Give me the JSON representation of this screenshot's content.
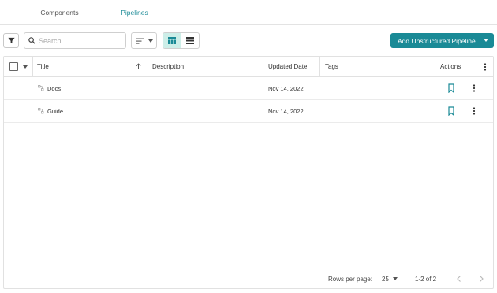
{
  "tabs": [
    {
      "label": "Components"
    },
    {
      "label": "Pipelines"
    }
  ],
  "toolbar": {
    "search_placeholder": "Search",
    "add_button_label": "Add Unstructured Pipeline"
  },
  "table": {
    "columns": {
      "title": "Title",
      "description": "Description",
      "updated_date": "Updated Date",
      "tags": "Tags",
      "actions": "Actions"
    },
    "rows": [
      {
        "title": "Docs",
        "description": "",
        "updated_date": "Nov 14, 2022",
        "tags": ""
      },
      {
        "title": "Guide",
        "description": "",
        "updated_date": "Nov 14, 2022",
        "tags": ""
      }
    ]
  },
  "pagination": {
    "rows_per_page_label": "Rows per page:",
    "rows_per_page_value": "25",
    "range": "1-2 of 2"
  },
  "colors": {
    "accent": "#1a8a96",
    "view_active_bg": "#cdeee8"
  },
  "icons": [
    "filter-icon",
    "search-icon",
    "sort-icon",
    "grid-view-icon",
    "list-view-icon",
    "sort-ascending-icon",
    "pipeline-icon",
    "bookmark-icon",
    "more-vert-icon",
    "chevron-left-icon",
    "chevron-right-icon"
  ]
}
